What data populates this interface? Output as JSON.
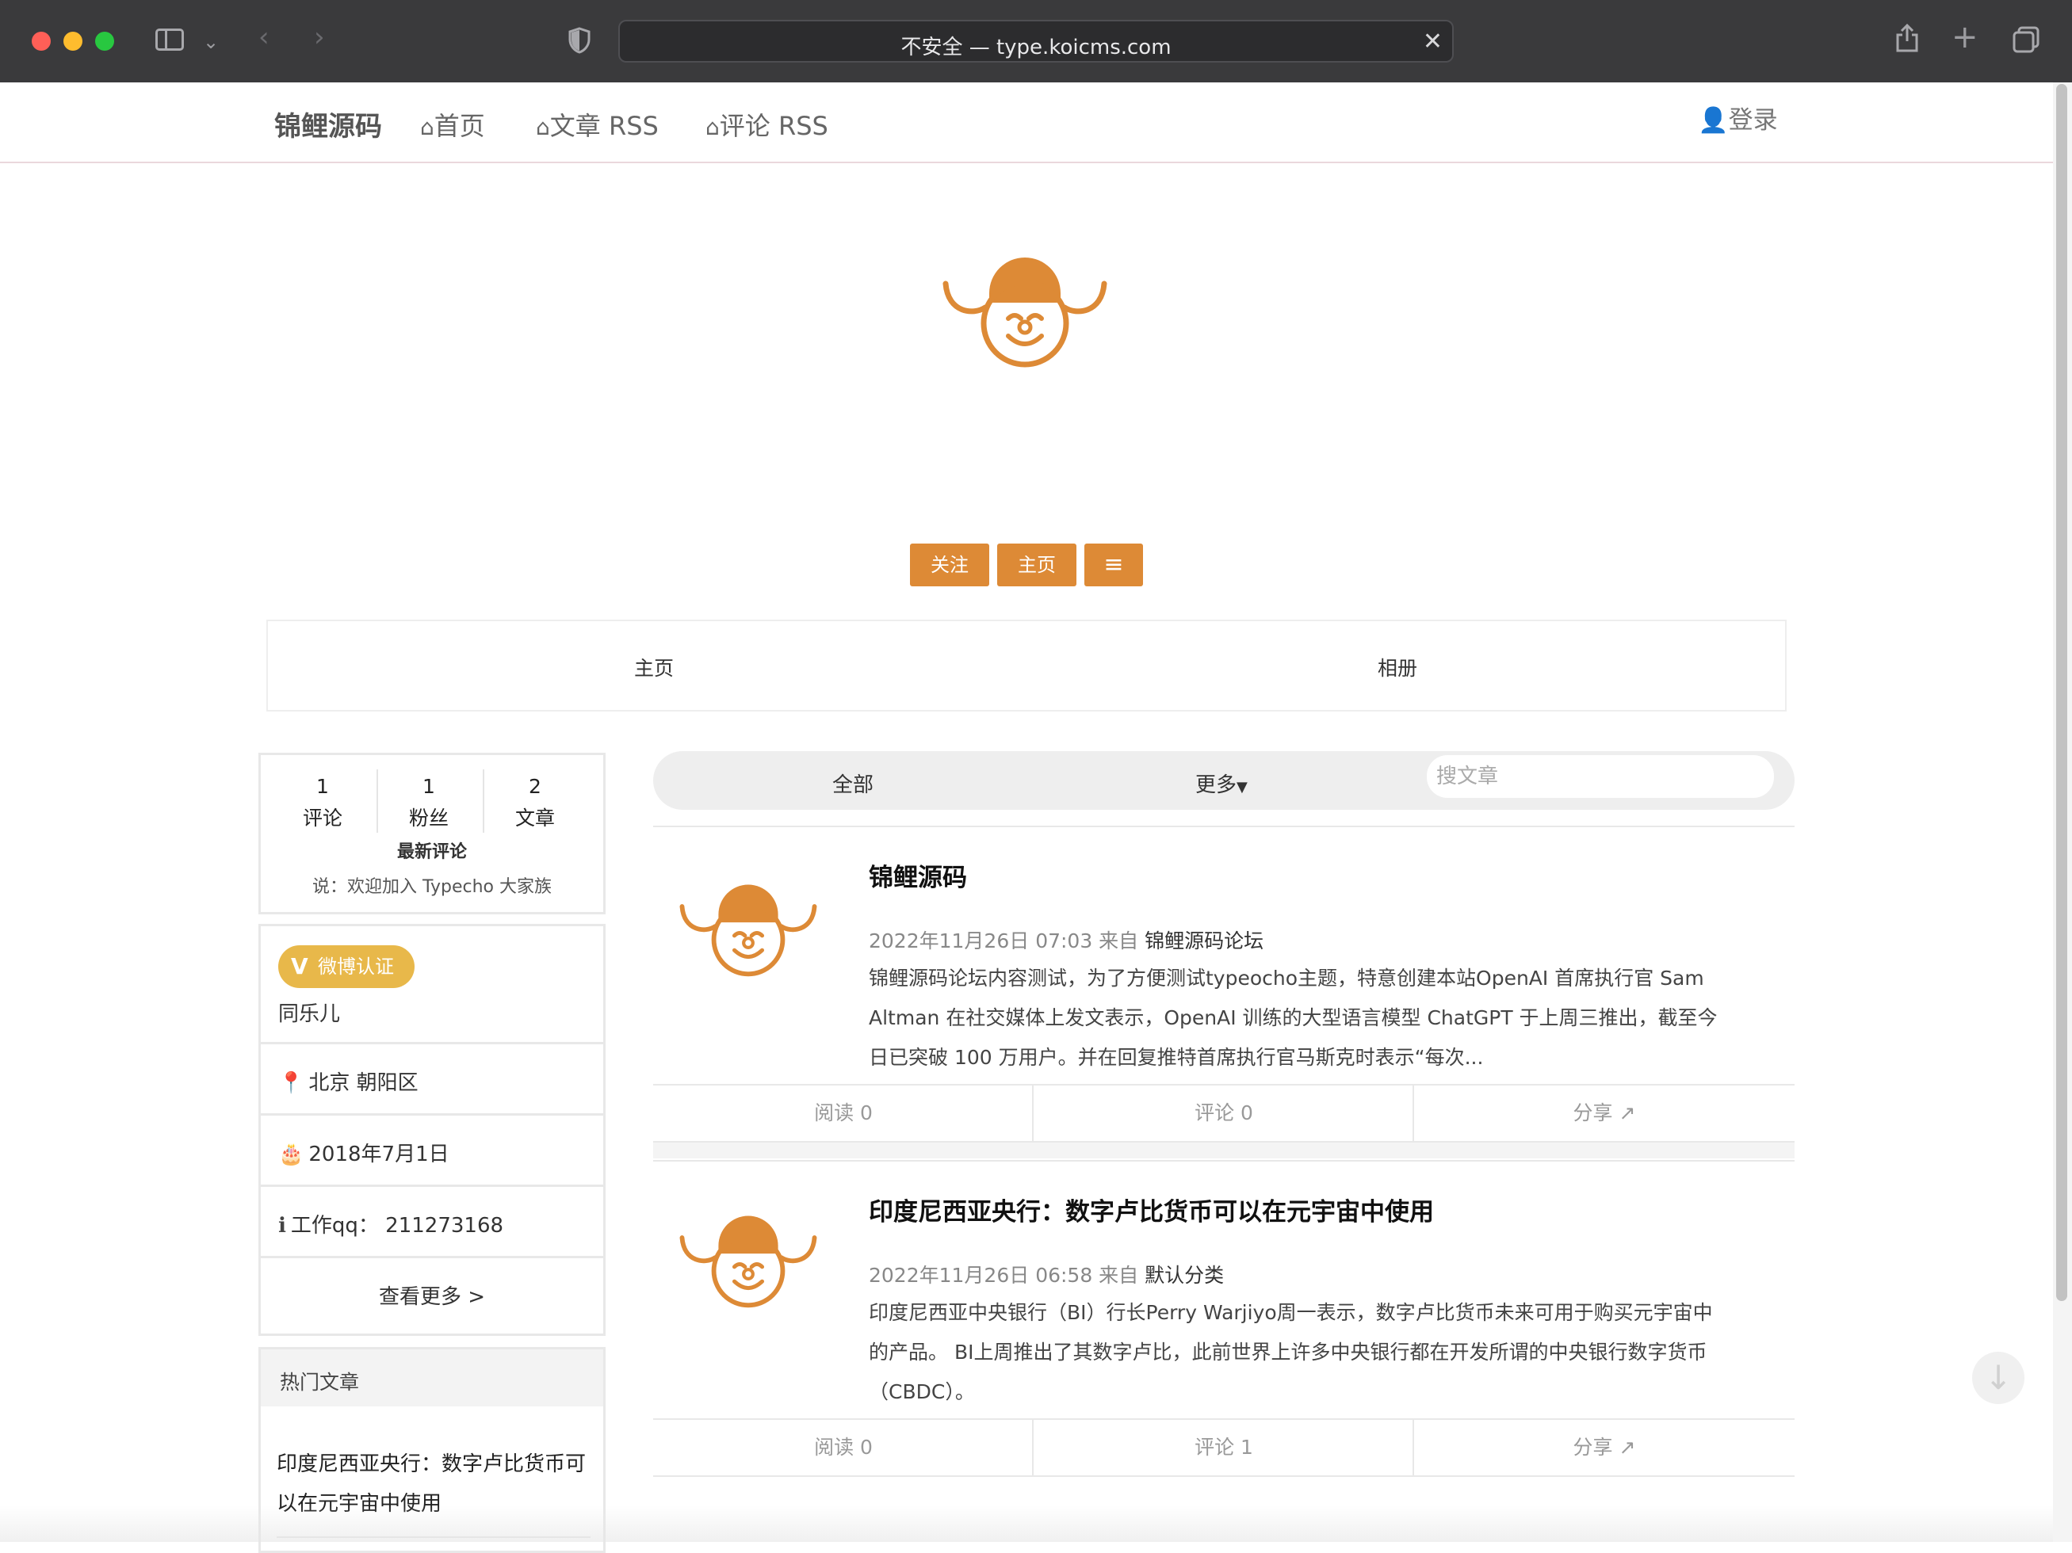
{
  "browser": {
    "url": "不安全 — type.koicms.com"
  },
  "nav": {
    "brand": "锦鲤源码",
    "links": [
      "首页",
      "文章 RSS",
      "评论 RSS"
    ],
    "login": "登录"
  },
  "hero": {
    "buttons": {
      "follow": "关注",
      "home": "主页"
    }
  },
  "tabs": [
    "主页",
    "相册"
  ],
  "stats": {
    "items": [
      {
        "value": "1",
        "label": "评论"
      },
      {
        "value": "1",
        "label": "粉丝"
      },
      {
        "value": "2",
        "label": "文章"
      }
    ],
    "latest_title": "最新评论",
    "latest_text": "说：欢迎加入 Typecho 大家族"
  },
  "profile": {
    "badge": "微博认证",
    "badge_letter": "V",
    "name": "同乐儿",
    "location": "北京 朝阳区",
    "birthday": "2018年7月1日",
    "qq": "工作qq： 211273168",
    "more": "查看更多 >"
  },
  "hot": {
    "title": "热门文章",
    "items": [
      "印度尼西亚央行：数字卢比货币可以在元宇宙中使用"
    ]
  },
  "filter": {
    "all": "全部",
    "more": "更多",
    "search_placeholder": "搜文章"
  },
  "articles": [
    {
      "title": "锦鲤源码",
      "date": "2022年11月26日 07:03 来自",
      "category": "锦鲤源码论坛",
      "excerpt_lines": [
        "锦鲤源码论坛内容测试，为了方便测试typeocho主题，特意创建本站OpenAI 首席执行官 Sam",
        "Altman 在社交媒体上发文表示，OpenAI 训练的大型语言模型 ChatGPT 于上周三推出，截至今",
        "日已突破 100 万用户。并在回复推特首席执行官马斯克时表示“每次..."
      ],
      "reads": "阅读 0",
      "comments": "评论 0",
      "share": "分享"
    },
    {
      "title": "印度尼西亚央行：数字卢比货币可以在元宇宙中使用",
      "date": "2022年11月26日 06:58 来自",
      "category": "默认分类",
      "excerpt_lines": [
        "印度尼西亚中央银行（BI）行长Perry Warjiyo周一表示，数字卢比货币未来可用于购买元宇宙中",
        "的产品。 BI上周推出了其数字卢比，此前世界上许多中央银行都在开发所谓的中央银行数字货币",
        "（CBDC）。"
      ],
      "reads": "阅读 0",
      "comments": "评论 1",
      "share": "分享"
    }
  ],
  "colors": {
    "accent": "#dd8a36",
    "badge": "#e8b84a"
  }
}
